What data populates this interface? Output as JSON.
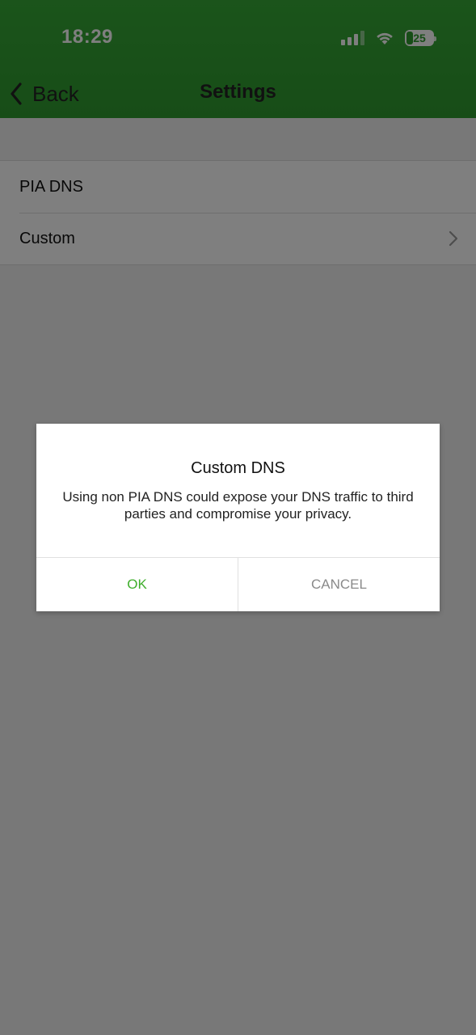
{
  "status_bar": {
    "time": "18:29",
    "battery_level": "25",
    "icons": [
      "signal-icon",
      "wifi-icon",
      "battery-icon"
    ]
  },
  "nav": {
    "back_label": "Back",
    "title": "Settings"
  },
  "dns_list": {
    "items": [
      {
        "label": "PIA DNS"
      },
      {
        "label": "Custom"
      }
    ]
  },
  "dialog": {
    "title": "Custom DNS",
    "message": "Using non PIA DNS could expose your DNS traffic to third parties and compromise your privacy.",
    "ok_label": "OK",
    "cancel_label": "CANCEL"
  },
  "colors": {
    "header_green": "#2f9a2f",
    "accent_green": "#3fae2c"
  }
}
